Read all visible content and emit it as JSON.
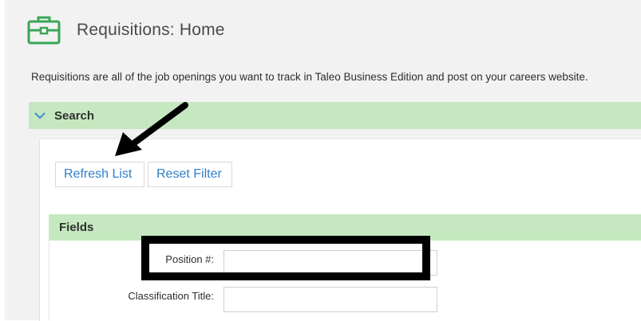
{
  "header": {
    "title": "Requisitions: Home",
    "icon": "briefcase-icon",
    "icon_color": "#3aa655"
  },
  "description": "Requisitions are all of the job openings you want to track in Taleo Business Edition and post on your careers website.",
  "search": {
    "label": "Search",
    "expanded_icon": "chevron-down-icon",
    "header_color": "#c6e8c0"
  },
  "buttons": {
    "refresh_label": "Refresh List",
    "reset_label": "Reset Filter",
    "link_color": "#2f7fc9"
  },
  "fields": {
    "label": "Fields",
    "position": {
      "label": "Position #:",
      "value": ""
    },
    "classification": {
      "label": "Classification Title:",
      "value": ""
    }
  },
  "annotations": {
    "arrow_icon": "arrow-pointer-icon",
    "highlight_color": "#000000"
  }
}
